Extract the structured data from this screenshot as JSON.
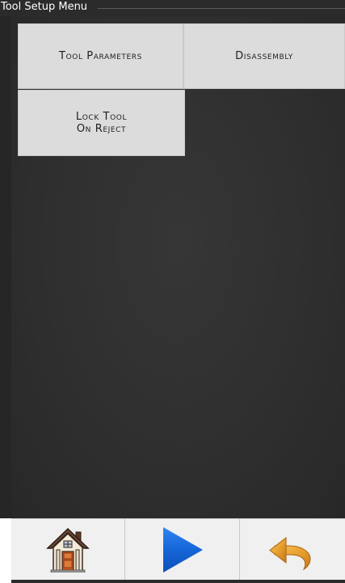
{
  "window": {
    "title": "Tool Setup Menu"
  },
  "menu": {
    "buttons": [
      {
        "id": "tool-parameters",
        "line1": "Tool Parameters",
        "line2": ""
      },
      {
        "id": "disassembly",
        "line1": "Disassembly",
        "line2": ""
      },
      {
        "id": "lock-tool-on-reject",
        "line1": "Lock Tool",
        "line2": "On Reject"
      }
    ]
  },
  "bottom_nav": {
    "items": [
      {
        "icon": "home-icon"
      },
      {
        "icon": "play-icon"
      },
      {
        "icon": "undo-arrow-icon"
      }
    ]
  },
  "colors": {
    "title_bar": "#2b2b2b",
    "panel": "#303030",
    "button_face": "#dcdcdc",
    "play_blue": "#1565d8",
    "undo_orange": "#e8a030"
  }
}
